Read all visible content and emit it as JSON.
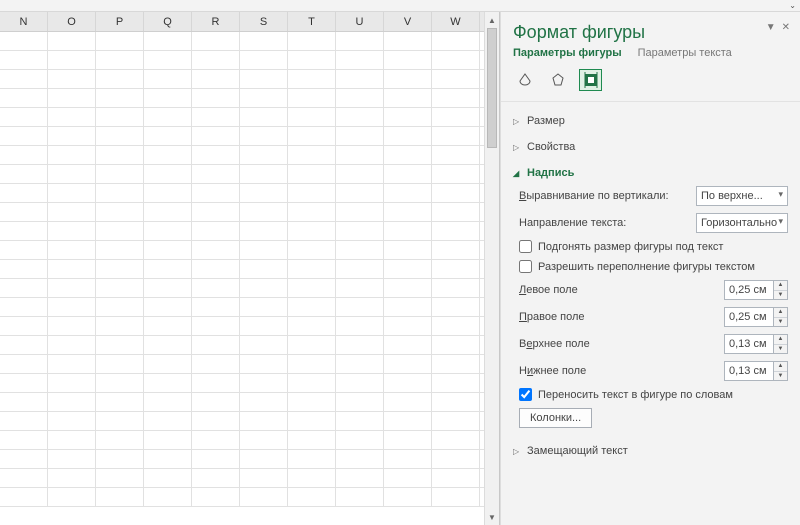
{
  "spreadsheet": {
    "columns": [
      "N",
      "O",
      "P",
      "Q",
      "R",
      "S",
      "T",
      "U",
      "V",
      "W"
    ],
    "visible_rows": 25
  },
  "panel": {
    "title": "Формат фигуры",
    "tabs": {
      "shape": "Параметры фигуры",
      "text": "Параметры текста"
    },
    "sections": {
      "size": "Размер",
      "properties": "Свойства",
      "textbox": "Надпись",
      "alttext": "Замещающий текст"
    },
    "textbox": {
      "valign_label": "Выравнивание по вертикали:",
      "valign_value": "По верхне...",
      "dir_label": "Направление текста:",
      "dir_value": "Горизонтально",
      "autofit_label": "Подгонять размер фигуры под текст",
      "overflow_label": "Разрешить переполнение фигуры текстом",
      "margin_left_label": "Левое поле",
      "margin_left_value": "0,25 см",
      "margin_right_label": "Правое поле",
      "margin_right_value": "0,25 см",
      "margin_top_label": "Верхнее поле",
      "margin_top_value": "0,13 см",
      "margin_bottom_label": "Нижнее поле",
      "margin_bottom_value": "0,13 см",
      "wrap_label": "Переносить текст в фигуре по словам",
      "columns_btn": "Колонки..."
    }
  }
}
